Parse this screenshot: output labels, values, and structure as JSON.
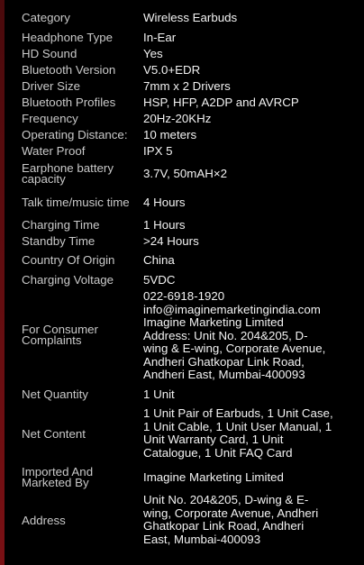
{
  "rows": [
    {
      "label": "Category",
      "value": "Wireless Earbuds"
    },
    {
      "label": "Headphone Type",
      "value": "In-Ear"
    },
    {
      "label": "HD Sound",
      "value": "Yes"
    },
    {
      "label": "Bluetooth Version",
      "value": "V5.0+EDR"
    },
    {
      "label": "Driver Size",
      "value": "7mm x 2 Drivers"
    },
    {
      "label": "Bluetooth Profiles",
      "value": "HSP, HFP, A2DP and AVRCP"
    },
    {
      "label": "Frequency",
      "value": "20Hz-20KHz"
    },
    {
      "label": "Operating Distance:",
      "value": "10 meters"
    },
    {
      "label": "Water Proof",
      "value": "IPX 5"
    },
    {
      "label": "Earphone battery capacity",
      "value": "3.7V, 50mAH×2"
    },
    {
      "label": "Talk time/music time",
      "value": "4 Hours"
    },
    {
      "label": "Charging Time",
      "value": "1 Hours"
    },
    {
      "label": "Standby Time",
      "value": ">24 Hours"
    },
    {
      "label": "Country Of Origin",
      "value": "China"
    },
    {
      "label": "Charging Voltage",
      "value": "5VDC"
    },
    {
      "label": "For Consumer Complaints",
      "value": "022-6918-1920 info@imaginemarketingindia.com Imagine Marketing Limited Address: Unit No. 204&205, D-wing & E-wing, Corporate Avenue, Andheri Ghatkopar Link Road, Andheri East, Mumbai-400093",
      "lines": [
        "022-6918-1920",
        "info@imaginemarketingindia.com",
        "Imagine Marketing Limited",
        "Address: Unit No. 204&205, D-",
        "wing & E-wing, Corporate Avenue,",
        "Andheri Ghatkopar Link Road,",
        "Andheri East, Mumbai-400093"
      ]
    },
    {
      "label": "Net Quantity",
      "value": "1 Unit"
    },
    {
      "label": "Net Content",
      "value": "1 Unit Pair of Earbuds, 1 Unit Case, 1 Unit Cable, 1 Unit User Manual, 1 Unit Warranty Card, 1 Unit Catalogue, 1 Unit FAQ Card",
      "lines": [
        "1 Unit Pair of Earbuds, 1 Unit Case,",
        "1 Unit Cable, 1 Unit User Manual, 1",
        "Unit Warranty Card, 1 Unit",
        "Catalogue, 1 Unit FAQ Card"
      ]
    },
    {
      "label": "Imported And Marketed By",
      "value": "Imagine Marketing Limited"
    },
    {
      "label": "Address",
      "value": "Unit No. 204&205, D-wing & E-wing, Corporate Avenue, Andheri Ghatkopar Link Road, Andheri East, Mumbai-400093",
      "lines": [
        "Unit No. 204&205, D-wing & E-",
        "wing, Corporate Avenue, Andheri",
        "Ghatkopar Link Road, Andheri",
        "East, Mumbai-400093"
      ]
    }
  ]
}
